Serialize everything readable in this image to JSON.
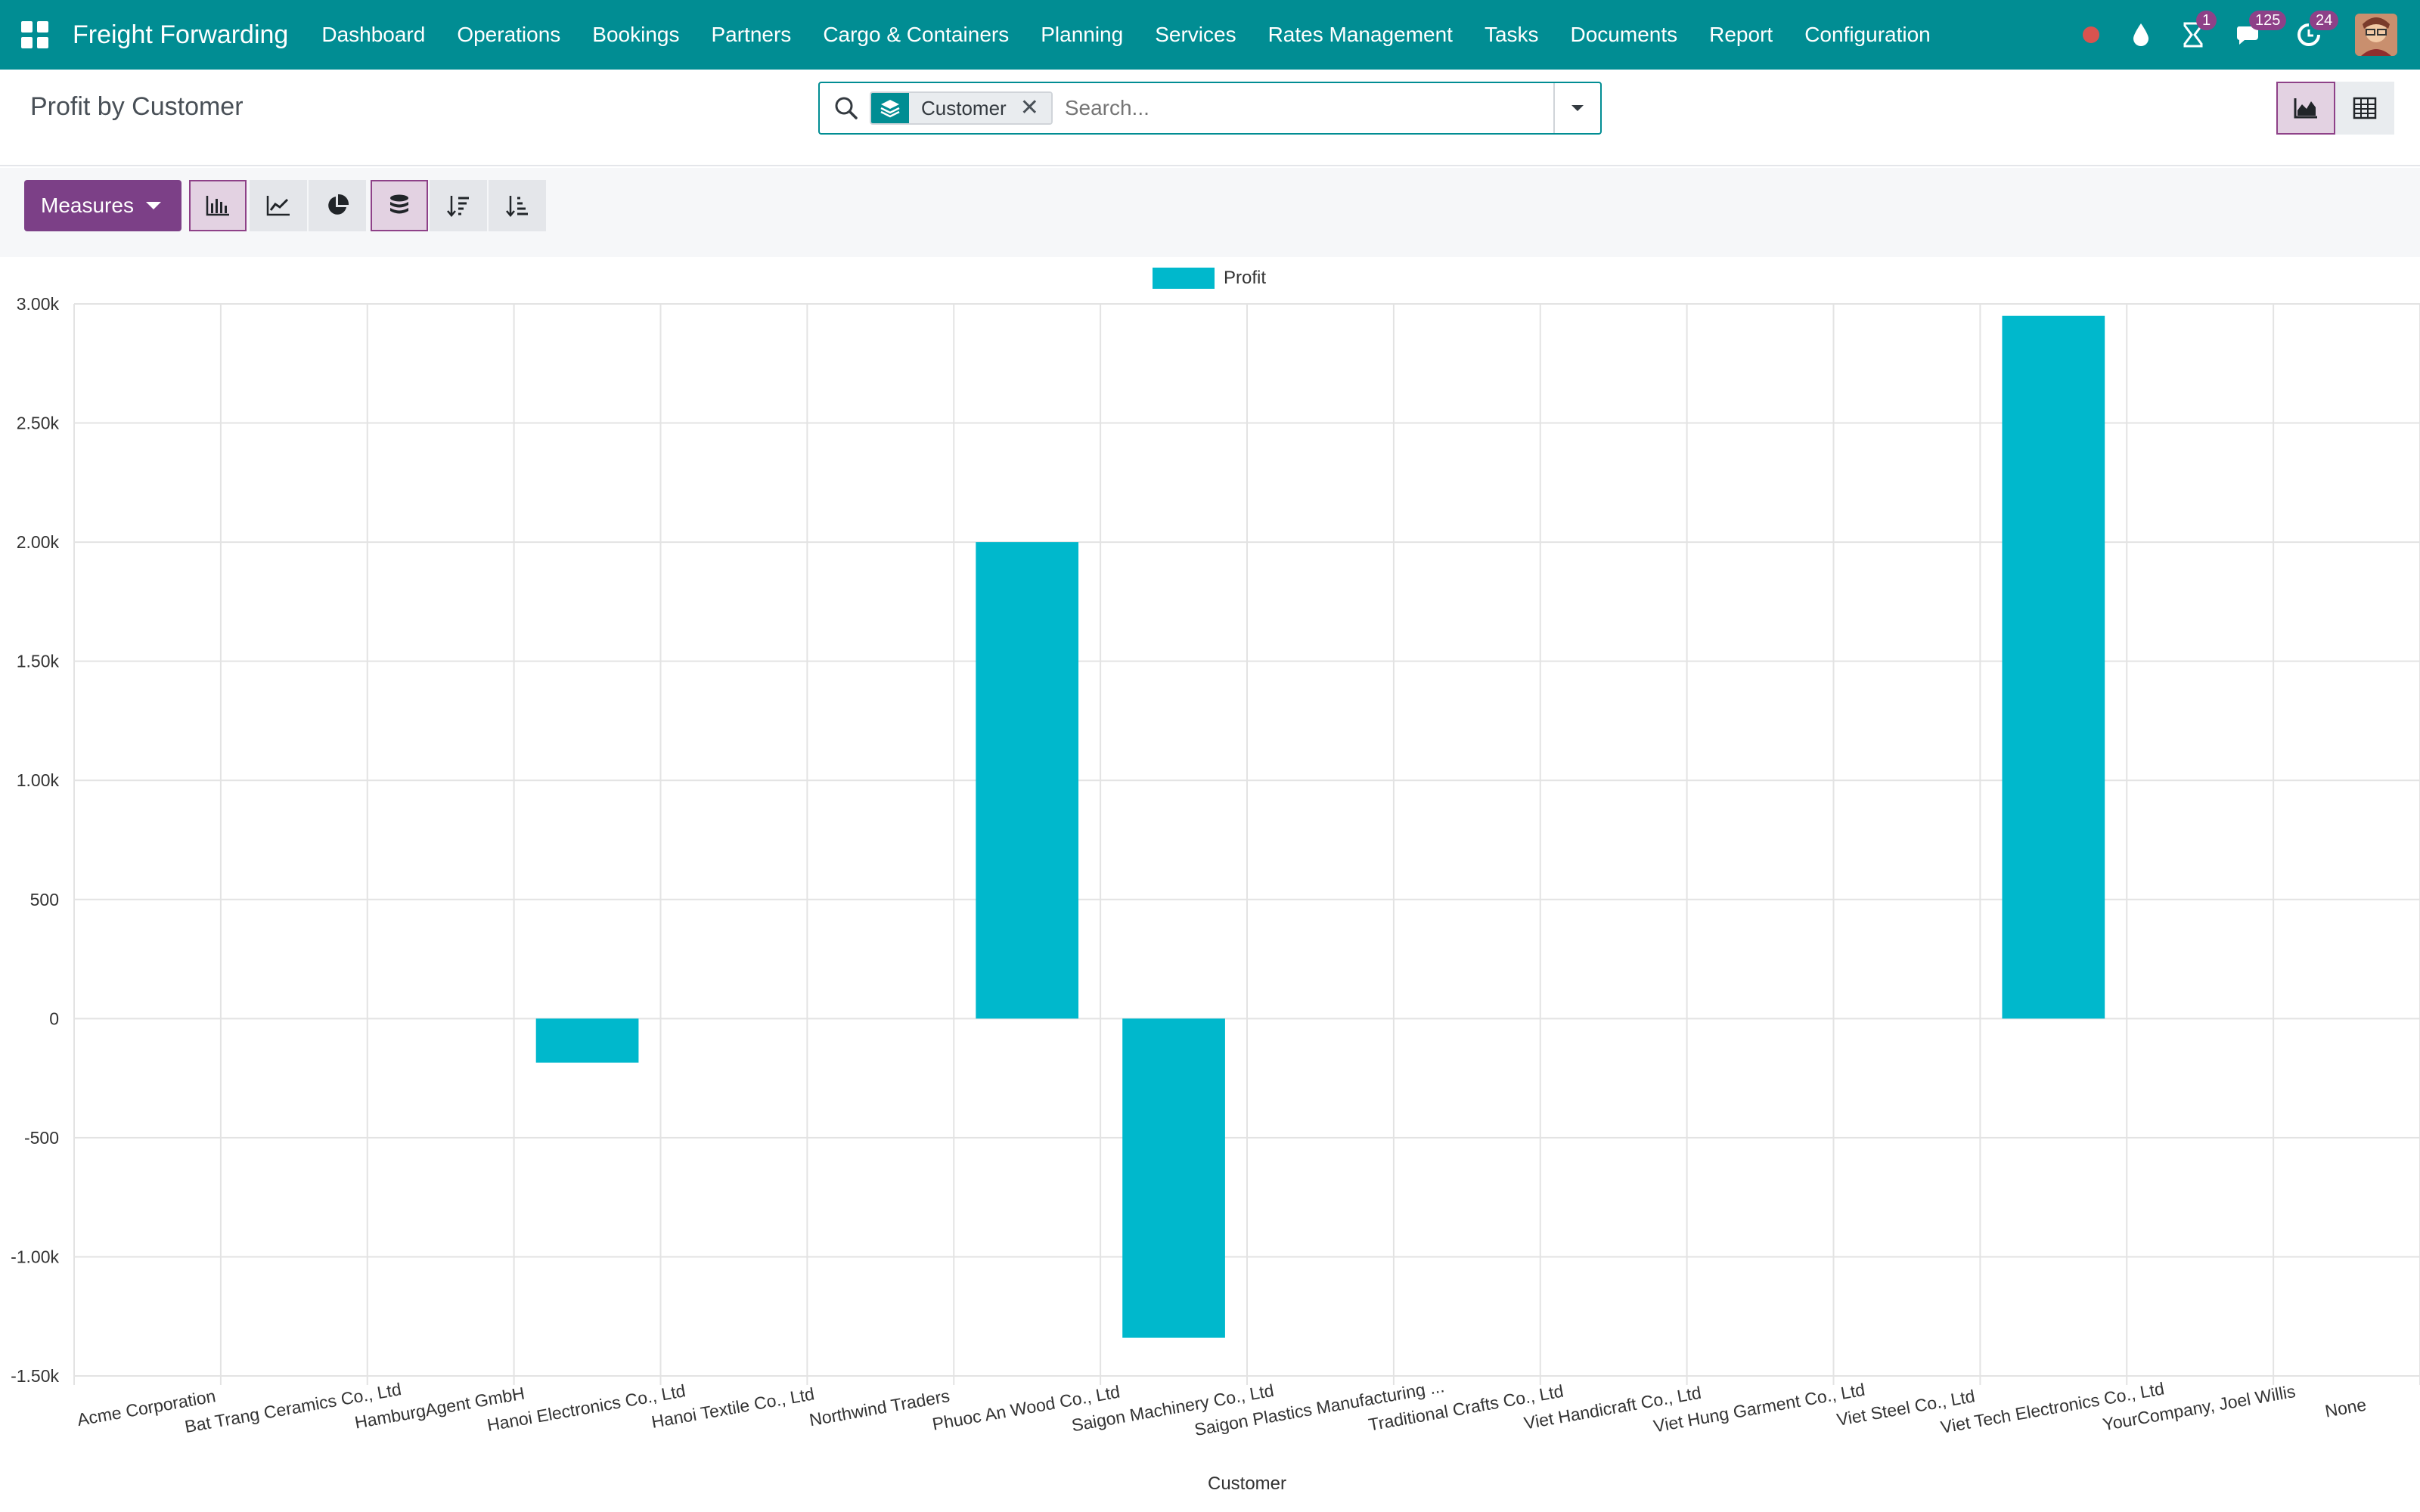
{
  "navbar": {
    "brand": "Freight Forwarding",
    "menu": [
      "Dashboard",
      "Operations",
      "Bookings",
      "Partners",
      "Cargo & Containers",
      "Planning",
      "Services",
      "Rates Management",
      "Tasks",
      "Documents",
      "Report",
      "Configuration"
    ],
    "badges": {
      "activities": "1",
      "messages": "125",
      "updates": "24"
    }
  },
  "control": {
    "title": "Profit by Customer",
    "facet": "Customer",
    "facet_close": "✕",
    "search_placeholder": "Search..."
  },
  "toolbar": {
    "measures_label": "Measures"
  },
  "colors": {
    "navbar": "#018d93",
    "accent": "#7c4087",
    "bar": "#00b8cc"
  },
  "chart_data": {
    "type": "bar",
    "title": "",
    "xlabel": "Customer",
    "ylabel": "",
    "legend": "Profit",
    "legend_position": "top-center",
    "grid": true,
    "ylim": [
      -1500,
      3000
    ],
    "yticks": [
      -1500,
      -1000,
      -500,
      0,
      500,
      1000,
      1500,
      2000,
      2500,
      3000
    ],
    "ytick_labels": [
      "-1.50k",
      "-1.00k",
      "-500",
      "0",
      "500",
      "1.00k",
      "1.50k",
      "2.00k",
      "2.50k",
      "3.00k"
    ],
    "categories": [
      "Acme Corporation",
      "Bat Trang Ceramics Co., Ltd",
      "HamburgAgent GmbH",
      "Hanoi Electronics Co., Ltd",
      "Hanoi Textile Co., Ltd",
      "Northwind Traders",
      "Phuoc An Wood Co., Ltd",
      "Saigon Machinery Co., Ltd",
      "Saigon Plastics Manufacturing ...",
      "Traditional Crafts Co., Ltd",
      "Viet Handicraft Co., Ltd",
      "Viet Hung Garment Co., Ltd",
      "Viet Steel Co., Ltd",
      "Viet Tech Electronics Co., Ltd",
      "YourCompany, Joel Willis",
      "None"
    ],
    "series": [
      {
        "name": "Profit",
        "values": [
          0,
          0,
          0,
          -185,
          0,
          0,
          2000,
          -1340,
          0,
          0,
          0,
          0,
          0,
          2950,
          0,
          0
        ]
      }
    ]
  }
}
